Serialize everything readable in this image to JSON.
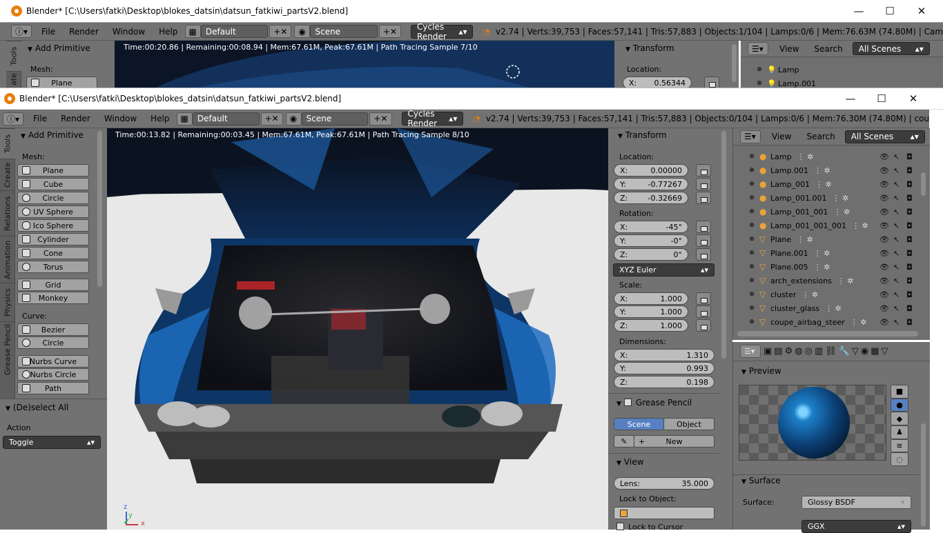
{
  "back_window": {
    "title": "Blender* [C:\\Users\\fatki\\Desktop\\blokes_datsin\\datsun_fatkiwi_partsV2.blend]",
    "menus": [
      "File",
      "Render",
      "Window",
      "Help"
    ],
    "layout": "Default",
    "scene": "Scene",
    "engine": "Cycles Render",
    "stats": "v2.74 | Verts:39,753 | Faces:57,141 | Tris:57,883 | Objects:1/104 | Lamps:0/6 | Mem:76.63M (74.80M) | Cam",
    "render_info": "Time:00:20.86 | Remaining:00:08.94 | Mem:67.61M, Peak:67.61M | Path Tracing Sample 7/10",
    "add_primitive": "Add Primitive",
    "mesh": "Mesh:",
    "plane": "Plane",
    "transform": "Transform",
    "location": "Location:",
    "loc_x_label": "X:",
    "loc_x": "0.56344",
    "outliner_view": "View",
    "outliner_search": "Search",
    "outliner_scenes": "All Scenes",
    "outliner_items": [
      "Lamp",
      "Lamp.001"
    ],
    "tabs": [
      "Tools",
      "ate"
    ]
  },
  "window": {
    "title": "Blender* [C:\\Users\\fatki\\Desktop\\blokes_datsin\\datsun_fatkiwi_partsV2.blend]",
    "menus": [
      "File",
      "Render",
      "Window",
      "Help"
    ],
    "layout": "Default",
    "scene": "Scene",
    "engine": "Cycles Render",
    "stats": "v2.74 | Verts:39,753 | Faces:57,141 | Tris:57,883 | Objects:0/104 | Lamps:0/6 | Mem:76.30M (74.80M) | cou",
    "render_info": "Time:00:13.82 | Remaining:00:03.45 | Mem:67.61M, Peak:67.61M | Path Tracing Sample 8/10",
    "minimize": "—",
    "maximize": "☐",
    "close": "✕"
  },
  "tools": {
    "tabs": [
      "Tools",
      "Create",
      "Relations",
      "Animation",
      "Physics",
      "Grease Pencil"
    ],
    "add_primitive": "Add Primitive",
    "mesh_label": "Mesh:",
    "mesh": [
      "Plane",
      "Cube",
      "Circle",
      "UV Sphere",
      "Ico Sphere",
      "Cylinder",
      "Cone",
      "Torus"
    ],
    "mesh2": [
      "Grid",
      "Monkey"
    ],
    "curve_label": "Curve:",
    "curve": [
      "Bezier",
      "Circle"
    ],
    "nurbs": [
      "Nurbs Curve",
      "Nurbs Circle",
      "Path"
    ],
    "operator": "(De)select All",
    "action_label": "Action",
    "action_value": "Toggle"
  },
  "transform": {
    "title": "Transform",
    "location_label": "Location:",
    "location": [
      {
        "axis": "X:",
        "value": "0.00000"
      },
      {
        "axis": "Y:",
        "value": "-0.77267"
      },
      {
        "axis": "Z:",
        "value": "-0.32669"
      }
    ],
    "rotation_label": "Rotation:",
    "rotation": [
      {
        "axis": "X:",
        "value": "-45°"
      },
      {
        "axis": "Y:",
        "value": "-0°"
      },
      {
        "axis": "Z:",
        "value": "0°"
      }
    ],
    "rotation_mode": "XYZ Euler",
    "scale_label": "Scale:",
    "scale": [
      {
        "axis": "X:",
        "value": "1.000"
      },
      {
        "axis": "Y:",
        "value": "1.000"
      },
      {
        "axis": "Z:",
        "value": "1.000"
      }
    ],
    "dimensions_label": "Dimensions:",
    "dimensions": [
      {
        "axis": "X:",
        "value": "1.310"
      },
      {
        "axis": "Y:",
        "value": "0.993"
      },
      {
        "axis": "Z:",
        "value": "0.198"
      }
    ],
    "grease_pencil": "Grease Pencil",
    "gp_scene": "Scene",
    "gp_object": "Object",
    "gp_new": "New",
    "view": "View",
    "lens_label": "Lens:",
    "lens_value": "35.000",
    "lock_object": "Lock to Object:",
    "lock_cursor": "Lock to Cursor"
  },
  "outliner": {
    "view": "View",
    "search": "Search",
    "scenes": "All Scenes",
    "items": [
      "Lamp",
      "Lamp.001",
      "Lamp_001",
      "Lamp_001.001",
      "Lamp_001_001",
      "Lamp_001_001_001",
      "Plane",
      "Plane.001",
      "Plane.005",
      "arch_extensions",
      "cluster",
      "cluster_glass",
      "coupe_airbag_steer"
    ],
    "lamp_color": "#e8a33a",
    "mesh_color": "#e8a33a"
  },
  "properties": {
    "preview": "Preview",
    "surface": "Surface",
    "surface_label": "Surface:",
    "surface_value": "Glossy BSDF",
    "dist_value": "GGX"
  },
  "axes": {
    "x": "x",
    "y": "y",
    "z": "z"
  }
}
